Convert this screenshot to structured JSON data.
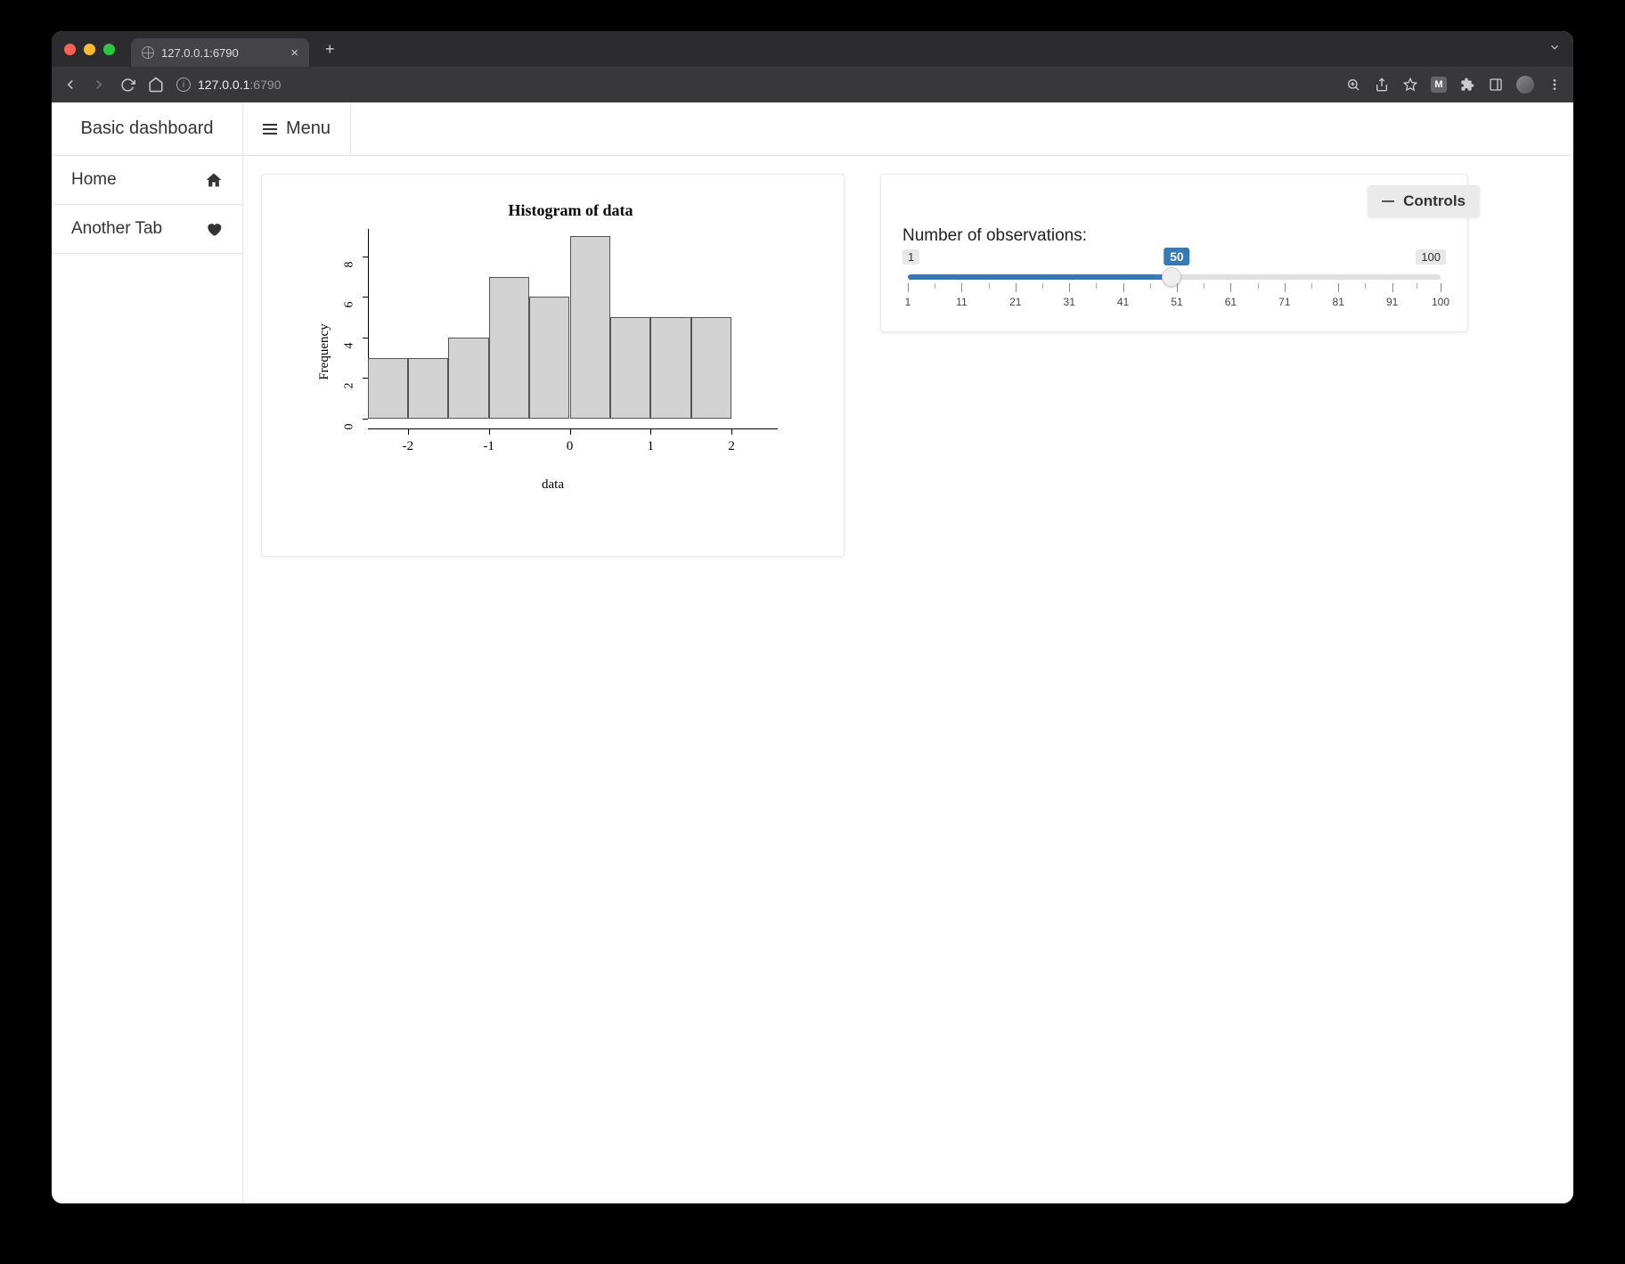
{
  "browser": {
    "tab_title": "127.0.0.1:6790",
    "url": "127.0.0.1",
    "url_port": ":6790"
  },
  "header": {
    "title": "Basic dashboard",
    "menu_label": "Menu"
  },
  "sidebar": {
    "items": [
      {
        "label": "Home",
        "icon": "home-icon"
      },
      {
        "label": "Another Tab",
        "icon": "heart-icon"
      }
    ]
  },
  "controls": {
    "panel_label": "Controls",
    "slider_label": "Number of observations:",
    "slider_min": "1",
    "slider_max": "100",
    "slider_value": "50",
    "tick_labels": [
      "1",
      "11",
      "21",
      "31",
      "41",
      "51",
      "61",
      "71",
      "81",
      "91",
      "100"
    ]
  },
  "chart_data": {
    "type": "bar",
    "title": "Histogram of data",
    "xlabel": "data",
    "ylabel": "Frequency",
    "x_ticks": [
      -2,
      -1,
      0,
      1,
      2
    ],
    "y_ticks": [
      0,
      2,
      4,
      6,
      8
    ],
    "xlim": [
      -2.5,
      2.5
    ],
    "ylim": [
      0,
      9
    ],
    "bin_edges": [
      -2.5,
      -2.0,
      -1.5,
      -1.0,
      -0.5,
      0.0,
      0.5,
      1.0,
      1.5,
      2.0
    ],
    "values": [
      3,
      3,
      4,
      7,
      6,
      9,
      5,
      5,
      5
    ]
  }
}
